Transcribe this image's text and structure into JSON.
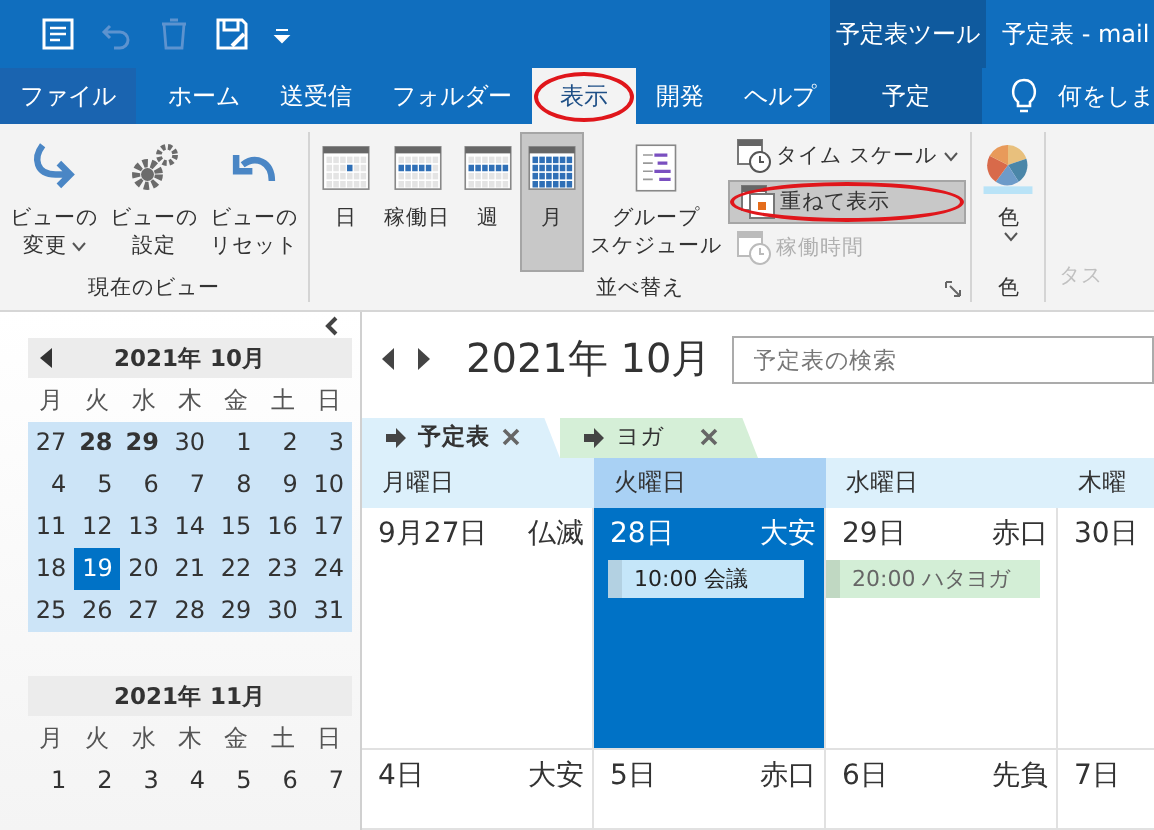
{
  "quick_access": [
    {
      "kind": "app",
      "disabled": false
    },
    {
      "kind": "undo",
      "disabled": true
    },
    {
      "kind": "delete",
      "disabled": true
    },
    {
      "kind": "save",
      "disabled": false
    },
    {
      "kind": "customize",
      "disabled": false
    }
  ],
  "context_group": "予定表ツール",
  "window_title": "予定表 - mail",
  "tabs": [
    {
      "label": "ファイル",
      "selected": false,
      "highlighted": false
    },
    {
      "label": "ホーム",
      "selected": false,
      "highlighted": false
    },
    {
      "label": "送受信",
      "selected": false,
      "highlighted": false
    },
    {
      "label": "フォルダー",
      "selected": false,
      "highlighted": false
    },
    {
      "label": "表示",
      "selected": true,
      "highlighted": true
    },
    {
      "label": "開発",
      "selected": false,
      "highlighted": false
    },
    {
      "label": "ヘルプ",
      "selected": false,
      "highlighted": false
    }
  ],
  "context_tabs": [
    {
      "label": "予定",
      "selected": false
    }
  ],
  "tell_me": "何をしま",
  "ribbon": {
    "groups": [
      {
        "label": "現在のビュー",
        "buttons": [
          {
            "kind": "change-view",
            "lines": [
              "ビューの",
              "変更"
            ],
            "dropdown": true,
            "selected": false
          },
          {
            "kind": "settings",
            "lines": [
              "ビューの",
              "設定"
            ],
            "dropdown": false,
            "selected": false
          },
          {
            "kind": "reset",
            "lines": [
              "ビューの",
              "リセット"
            ],
            "dropdown": false,
            "selected": false
          }
        ],
        "launcher": false
      },
      {
        "label": "並べ替え",
        "buttons": [
          {
            "kind": "day",
            "lines": [
              "日"
            ],
            "dropdown": false,
            "selected": false
          },
          {
            "kind": "workweek",
            "lines": [
              "稼働日"
            ],
            "dropdown": false,
            "selected": false
          },
          {
            "kind": "week",
            "lines": [
              "週"
            ],
            "dropdown": false,
            "selected": false
          },
          {
            "kind": "month",
            "lines": [
              "月"
            ],
            "dropdown": false,
            "selected": true
          },
          {
            "kind": "schedule",
            "lines": [
              "グループ",
              "スケジュール"
            ],
            "dropdown": false,
            "selected": false
          }
        ],
        "small_buttons": [
          {
            "kind": "timescale",
            "label": "タイム スケール",
            "dropdown": true,
            "selected": false,
            "disabled": false,
            "highlighted": false
          },
          {
            "kind": "overlay",
            "label": "重ねて表示",
            "dropdown": false,
            "selected": true,
            "disabled": false,
            "highlighted": true
          },
          {
            "kind": "workhours",
            "label": "稼働時間",
            "dropdown": false,
            "selected": false,
            "disabled": true,
            "highlighted": false
          }
        ],
        "launcher": true
      },
      {
        "label": "色",
        "buttons": [
          {
            "kind": "color",
            "lines": [
              "色"
            ],
            "dropdown": true,
            "selected": false
          }
        ],
        "launcher": false
      }
    ],
    "cut_group": "タス"
  },
  "mini_calendars": [
    {
      "title": "2021年 10月",
      "weekdays": [
        "月",
        "火",
        "水",
        "木",
        "金",
        "土",
        "日"
      ],
      "weeks": [
        {
          "highlighted": true,
          "days": [
            {
              "d": "27",
              "bold": false,
              "selected": false
            },
            {
              "d": "28",
              "bold": true,
              "selected": false
            },
            {
              "d": "29",
              "bold": true,
              "selected": false
            },
            {
              "d": "30",
              "bold": false,
              "selected": false
            },
            {
              "d": "1",
              "bold": false,
              "selected": false
            },
            {
              "d": "2",
              "bold": false,
              "selected": false
            },
            {
              "d": "3",
              "bold": false,
              "selected": false
            }
          ]
        },
        {
          "highlighted": true,
          "days": [
            {
              "d": "4",
              "bold": false,
              "selected": false
            },
            {
              "d": "5",
              "bold": false,
              "selected": false
            },
            {
              "d": "6",
              "bold": false,
              "selected": false
            },
            {
              "d": "7",
              "bold": false,
              "selected": false
            },
            {
              "d": "8",
              "bold": false,
              "selected": false
            },
            {
              "d": "9",
              "bold": false,
              "selected": false
            },
            {
              "d": "10",
              "bold": false,
              "selected": false
            }
          ]
        },
        {
          "highlighted": true,
          "days": [
            {
              "d": "11",
              "bold": false,
              "selected": false
            },
            {
              "d": "12",
              "bold": false,
              "selected": false
            },
            {
              "d": "13",
              "bold": false,
              "selected": false
            },
            {
              "d": "14",
              "bold": false,
              "selected": false
            },
            {
              "d": "15",
              "bold": false,
              "selected": false
            },
            {
              "d": "16",
              "bold": false,
              "selected": false
            },
            {
              "d": "17",
              "bold": false,
              "selected": false
            }
          ]
        },
        {
          "highlighted": true,
          "days": [
            {
              "d": "18",
              "bold": false,
              "selected": false
            },
            {
              "d": "19",
              "bold": false,
              "selected": true
            },
            {
              "d": "20",
              "bold": false,
              "selected": false
            },
            {
              "d": "21",
              "bold": false,
              "selected": false
            },
            {
              "d": "22",
              "bold": false,
              "selected": false
            },
            {
              "d": "23",
              "bold": false,
              "selected": false
            },
            {
              "d": "24",
              "bold": false,
              "selected": false
            }
          ]
        },
        {
          "highlighted": true,
          "days": [
            {
              "d": "25",
              "bold": false,
              "selected": false
            },
            {
              "d": "26",
              "bold": false,
              "selected": false
            },
            {
              "d": "27",
              "bold": false,
              "selected": false
            },
            {
              "d": "28",
              "bold": false,
              "selected": false
            },
            {
              "d": "29",
              "bold": false,
              "selected": false
            },
            {
              "d": "30",
              "bold": false,
              "selected": false
            },
            {
              "d": "31",
              "bold": false,
              "selected": false
            }
          ]
        }
      ]
    },
    {
      "title": "2021年 11月",
      "weekdays": [
        "月",
        "火",
        "水",
        "木",
        "金",
        "土",
        "日"
      ],
      "weeks": [
        {
          "days": [
            {
              "d": "1",
              "bold": false,
              "selected": false
            },
            {
              "d": "2",
              "bold": false,
              "selected": false
            },
            {
              "d": "3",
              "bold": false,
              "selected": false
            },
            {
              "d": "4",
              "bold": false,
              "selected": false
            },
            {
              "d": "5",
              "bold": false,
              "selected": false
            },
            {
              "d": "6",
              "bold": false,
              "selected": false
            },
            {
              "d": "7",
              "bold": false,
              "selected": false
            }
          ]
        }
      ]
    }
  ],
  "calendar": {
    "title": "2021年 10月",
    "search": {
      "placeholder": "予定表の検索"
    },
    "tabs": [
      {
        "label": "予定表",
        "selected": true,
        "color": "#dcf0fb"
      },
      {
        "label": "ヨガ",
        "selected": false,
        "color": "#d5efd7"
      }
    ],
    "day_headers": [
      {
        "label": "月曜日",
        "selected": false
      },
      {
        "label": "火曜日",
        "selected": true
      },
      {
        "label": "水曜日",
        "selected": false
      },
      {
        "label": "木曜",
        "selected": false
      }
    ],
    "weeks": [
      {
        "cells": [
          {
            "date": "9月27日",
            "rokuyo": "仏滅",
            "selected": false
          },
          {
            "date": "28日",
            "rokuyo": "大安",
            "selected": true,
            "events": [
              {
                "text": "10:00 会議",
                "color": "#c5e6f9"
              }
            ]
          },
          {
            "date": "29日",
            "rokuyo": "赤口",
            "selected": false,
            "events": [
              {
                "text": "20:00 ハタヨガ",
                "color": "#d3eed6"
              }
            ]
          },
          {
            "date": "30日",
            "selected": false
          }
        ]
      },
      {
        "cells": [
          {
            "date": "4日",
            "rokuyo": "大安",
            "selected": false
          },
          {
            "date": "5日",
            "rokuyo": "赤口",
            "selected": false
          },
          {
            "date": "6日",
            "rokuyo": "先負",
            "selected": false
          },
          {
            "date": "7日",
            "selected": false
          }
        ]
      }
    ]
  }
}
